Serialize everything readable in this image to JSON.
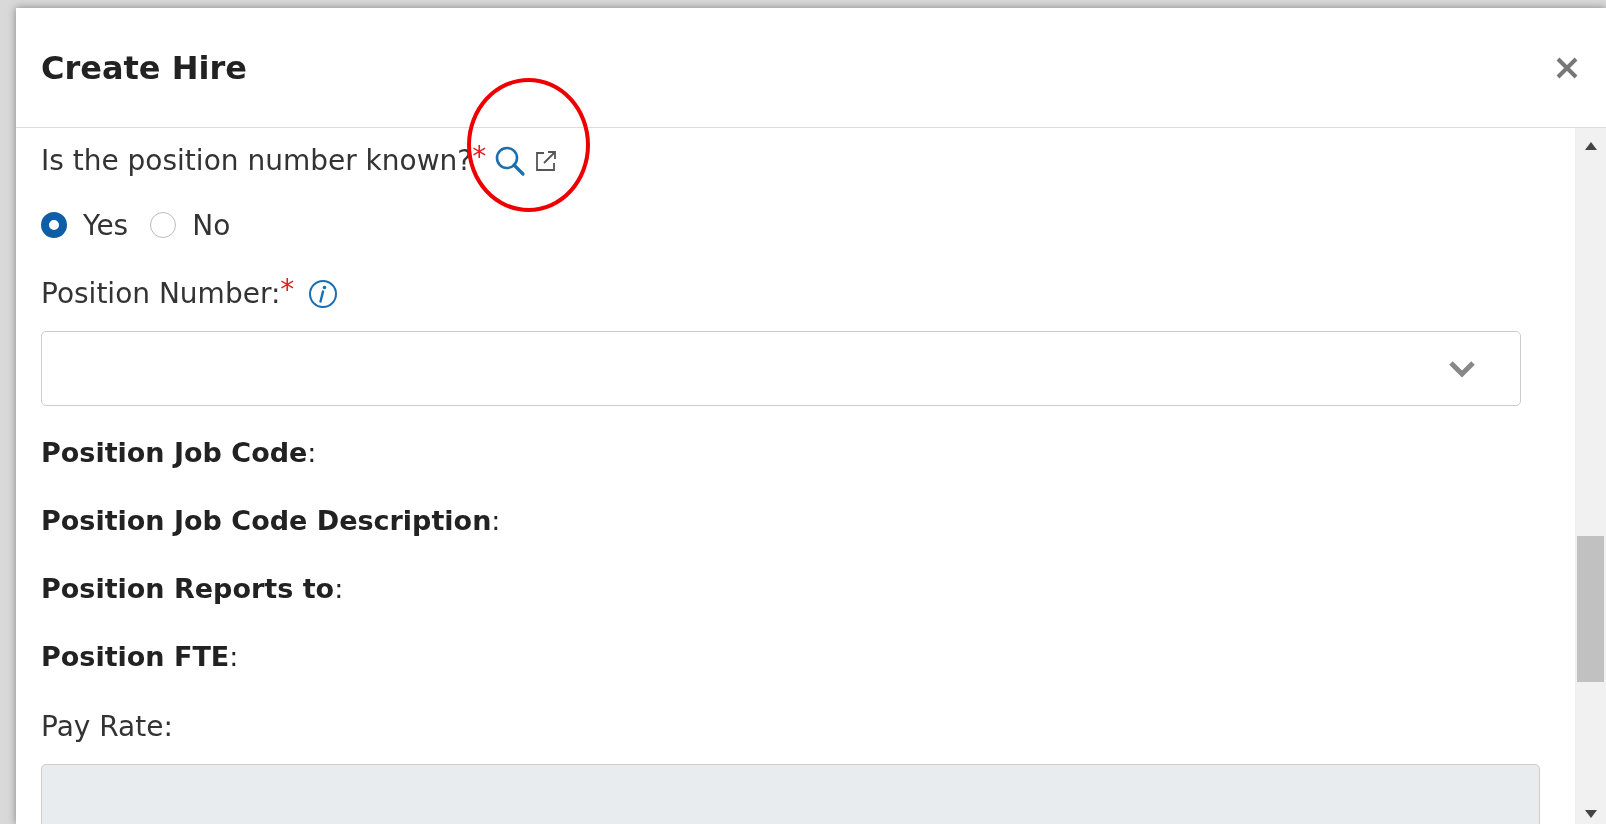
{
  "dialog": {
    "title": "Create Hire"
  },
  "question": {
    "label": "Is the position number known?",
    "required_mark": "*"
  },
  "options": [
    {
      "label": "Yes",
      "selected": true
    },
    {
      "label": "No",
      "selected": false
    }
  ],
  "position_number": {
    "label": "Position Number:",
    "required_mark": "*"
  },
  "details": [
    "**Position Job Code**:",
    "**Position Job Code Description**:",
    "**Position Reports to**:",
    "**Position FTE**:"
  ],
  "pay_rate": {
    "label": "Pay Rate:",
    "disabled": true
  }
}
